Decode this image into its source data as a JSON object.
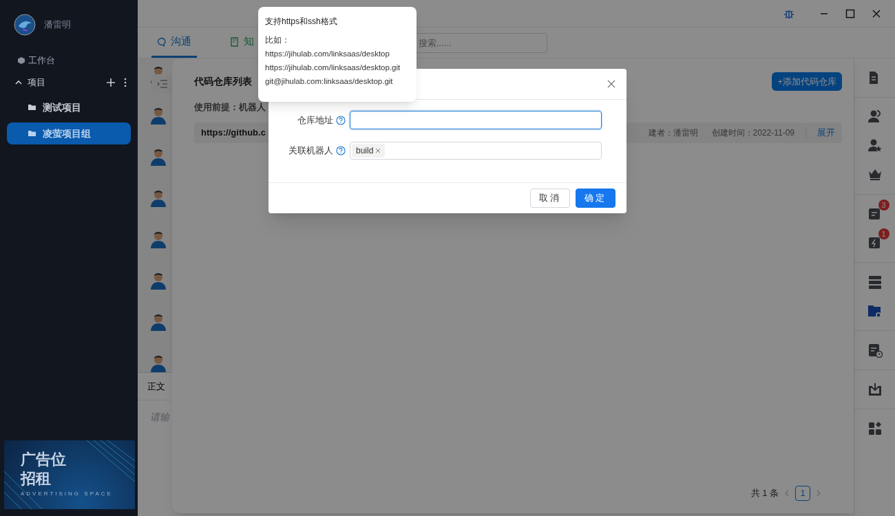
{
  "sidebar": {
    "user": "潘雷明",
    "workbench": "工作台",
    "section": {
      "label": "项目",
      "expanded": true
    },
    "projects": [
      {
        "label": "测试项目",
        "selected": false
      },
      {
        "label": "凌萤项目组",
        "selected": true
      }
    ],
    "ad": {
      "title_lines": [
        "广告位",
        "招租"
      ],
      "subtitle": "ADVERTISING SPACE"
    }
  },
  "tabs": [
    {
      "label": "沟通",
      "selected": true
    },
    {
      "label": "知",
      "selected": false
    }
  ],
  "search": {
    "placeholder": "搜索......"
  },
  "chat": {
    "editor_tab": "正文",
    "input_placeholder": "请输"
  },
  "repo_panel": {
    "title": "代码仓库列表",
    "add_button": "+添加代码仓库",
    "notice": "使用前提：机器人",
    "repos": [
      {
        "url": "https://github.c",
        "creator": "建者：潘雷明",
        "created": "创建时间：2022-11-09",
        "toggle": "展开"
      }
    ],
    "pagination": {
      "total": "共 1 条",
      "pages": [
        {
          "label": "1",
          "selected": true
        }
      ]
    }
  },
  "right_toolbar": [
    [
      {
        "selected": false
      }
    ],
    [
      {
        "selected": false
      },
      {
        "selected": false
      },
      {
        "selected": false
      }
    ],
    [
      {
        "selected": false,
        "badge": "3"
      },
      {
        "selected": false,
        "badge": "1"
      }
    ],
    [
      {
        "selected": false
      },
      {
        "selected": true
      }
    ],
    [
      {
        "selected": false
      }
    ],
    [
      {
        "selected": false
      }
    ],
    [
      {
        "selected": false
      }
    ]
  ],
  "dialog": {
    "fields": [
      {
        "label": "仓库地址",
        "kind": "text",
        "focused": true
      },
      {
        "label": "关联机器人",
        "kind": "tags",
        "tags": [
          "build"
        ]
      }
    ],
    "buttons": [
      {
        "label": "取消",
        "kind": "default"
      },
      {
        "label": "确定",
        "kind": "primary"
      }
    ]
  },
  "tooltip": {
    "title": "支持https和ssh格式",
    "lines": [
      "比如：",
      "https://jihulab.com/linksaas/desktop",
      "https://jihulab.com/linksaas/desktop.git",
      "git@jihulab.com:linksaas/desktop.git"
    ]
  }
}
